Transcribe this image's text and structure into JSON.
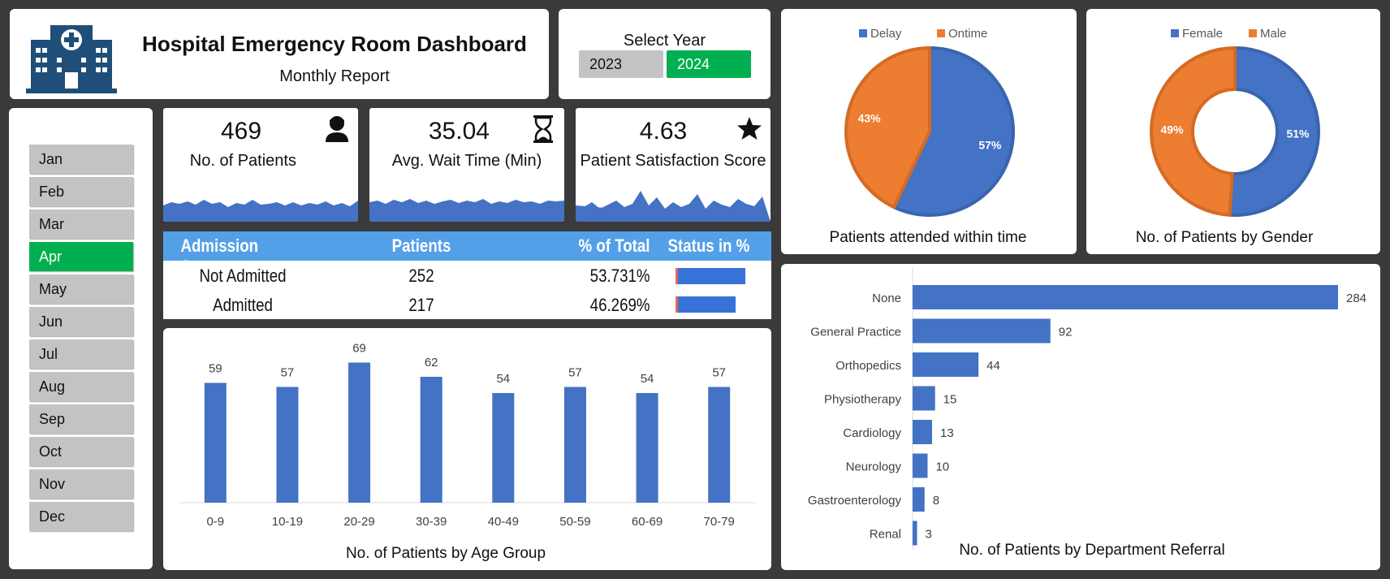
{
  "header": {
    "title": "Hospital Emergency Room Dashboard",
    "subtitle": "Monthly Report"
  },
  "year_select": {
    "label": "Select Year",
    "options": [
      "2023",
      "2024"
    ],
    "selected": "2024"
  },
  "months": {
    "items": [
      "Jan",
      "Feb",
      "Mar",
      "Apr",
      "May",
      "Jun",
      "Jul",
      "Aug",
      "Sep",
      "Oct",
      "Nov",
      "Dec"
    ],
    "selected": "Apr"
  },
  "kpis": [
    {
      "value": "469",
      "label": "No. of Patients",
      "icon": "patient-icon"
    },
    {
      "value": "35.04",
      "label": "Avg. Wait Time (Min)",
      "icon": "hourglass-icon"
    },
    {
      "value": "4.63",
      "label": "Patient Satisfaction Score",
      "icon": "star-icon"
    }
  ],
  "admission_table": {
    "headers": [
      "Admission Status",
      "Patients",
      "% of Total",
      "Status in %"
    ],
    "rows": [
      {
        "status": "Not Admitted",
        "patients": "252",
        "pct": "53.731%",
        "fraction": 0.53731
      },
      {
        "status": "Admitted",
        "patients": "217",
        "pct": "46.269%",
        "fraction": 0.46269
      }
    ]
  },
  "colors": {
    "blue": "#4472c4",
    "orange": "#ed7d31",
    "green": "#00b050",
    "grey": "#c3c3c3",
    "table_header": "#54a0e8",
    "logo": "#1f4e79"
  },
  "chart_data": [
    {
      "type": "bar",
      "title": "No. of Patients by Age Group",
      "categories": [
        "0-9",
        "10-19",
        "20-29",
        "30-39",
        "40-49",
        "50-59",
        "60-69",
        "70-79"
      ],
      "values": [
        59,
        57,
        69,
        62,
        54,
        57,
        54,
        57
      ],
      "ylim": [
        0,
        80
      ],
      "grid": false
    },
    {
      "type": "pie",
      "title": "Patients attended within time",
      "labels": [
        "Delay",
        "Ontime"
      ],
      "values": [
        57,
        43
      ],
      "value_labels": [
        "57%",
        "43%"
      ],
      "legend": "top"
    },
    {
      "type": "pie",
      "subtype": "donut",
      "title": "No. of Patients by Gender",
      "labels": [
        "Female",
        "Male"
      ],
      "values": [
        51,
        49
      ],
      "value_labels": [
        "51%",
        "49%"
      ],
      "legend": "top"
    },
    {
      "type": "bar",
      "orientation": "horizontal",
      "title": "No. of Patients by Department Referral",
      "categories": [
        "None",
        "General Practice",
        "Orthopedics",
        "Physiotherapy",
        "Cardiology",
        "Neurology",
        "Gastroenterology",
        "Renal"
      ],
      "values": [
        284,
        92,
        44,
        15,
        13,
        10,
        8,
        3
      ],
      "xlim": [
        0,
        284
      ]
    }
  ]
}
